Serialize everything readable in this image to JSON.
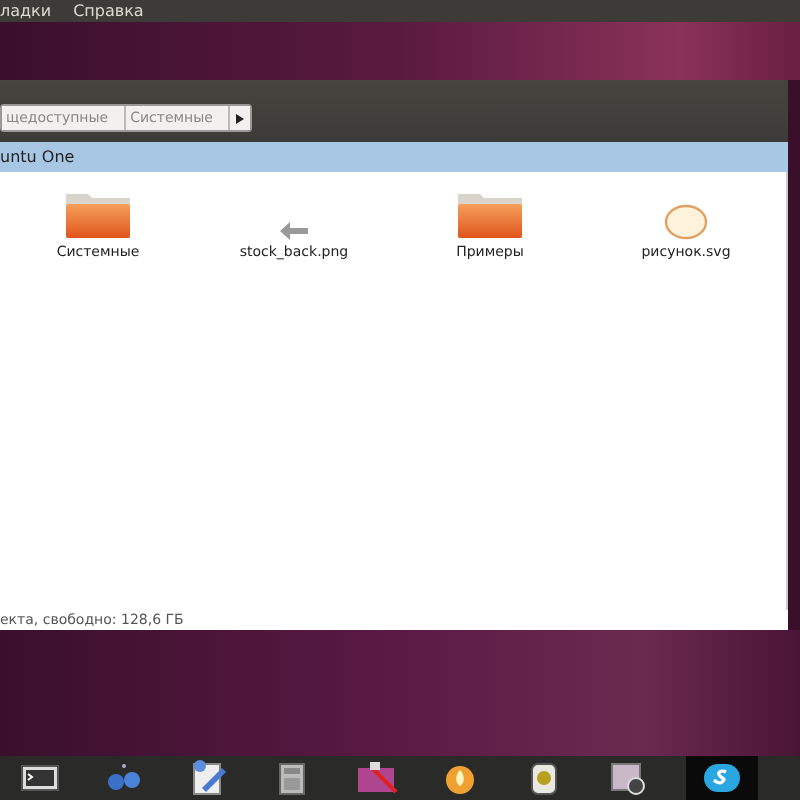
{
  "menu_bar": {
    "items": [
      "ладки",
      "Справка"
    ]
  },
  "path_bar": {
    "segments": [
      "щедоступные",
      "Системные"
    ]
  },
  "places_header": {
    "title": "untu One"
  },
  "files": [
    {
      "name": "Системные",
      "kind": "folder"
    },
    {
      "name": "stock_back.png",
      "kind": "arrow"
    },
    {
      "name": "Примеры",
      "kind": "folder"
    },
    {
      "name": "рисунок.svg",
      "kind": "ellipse"
    }
  ],
  "status_bar": {
    "text": "екта, свободно: 128,6 ГБ"
  },
  "dock": [
    {
      "kind": "terminal",
      "selected": false
    },
    {
      "kind": "dots",
      "selected": false
    },
    {
      "kind": "editor",
      "selected": false
    },
    {
      "kind": "calculator",
      "selected": false
    },
    {
      "kind": "image",
      "selected": false
    },
    {
      "kind": "flame",
      "selected": false
    },
    {
      "kind": "speaker",
      "selected": false
    },
    {
      "kind": "screenshot",
      "selected": false
    },
    {
      "kind": "chat",
      "selected": true
    }
  ]
}
